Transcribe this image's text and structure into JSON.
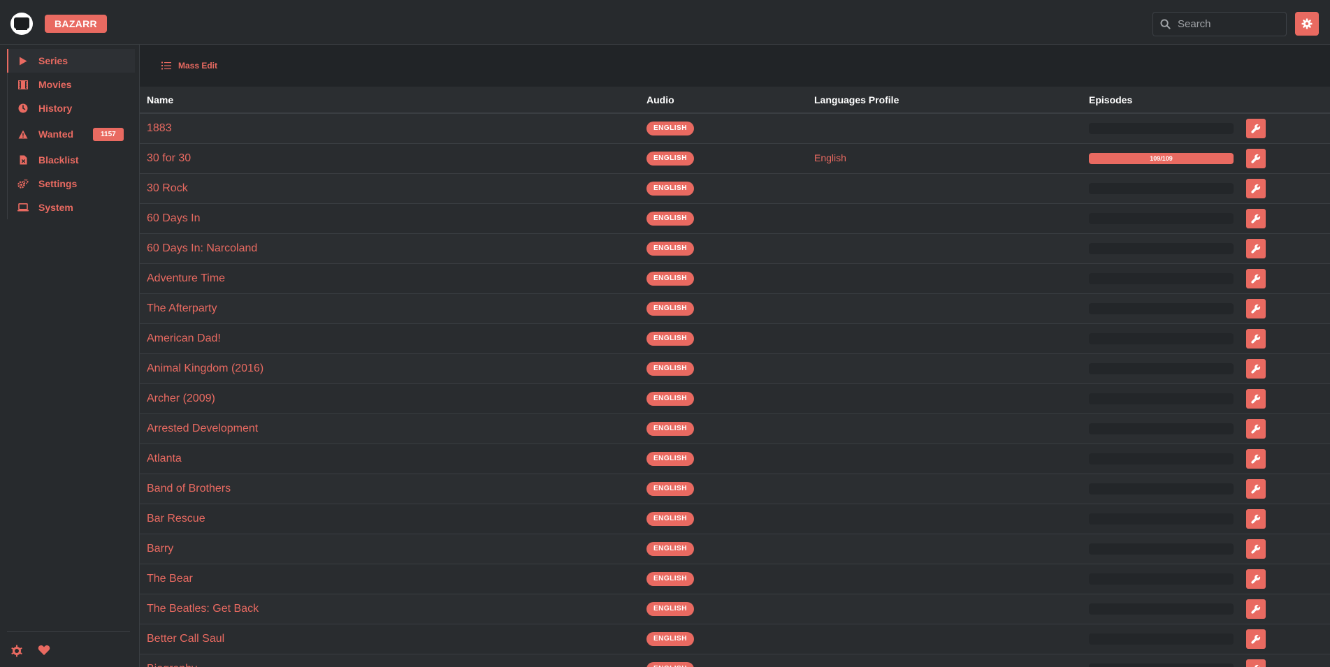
{
  "header": {
    "brand": "BAZARR",
    "search_placeholder": "Search"
  },
  "colors": {
    "accent": "#e96a61",
    "background": "#272a2d"
  },
  "sidebar": {
    "items": [
      {
        "label": "Series",
        "icon": "play-icon",
        "active": true
      },
      {
        "label": "Movies",
        "icon": "film-icon"
      },
      {
        "label": "History",
        "icon": "clock-icon"
      },
      {
        "label": "Wanted",
        "icon": "warning-icon",
        "badge": "1157"
      },
      {
        "label": "Blacklist",
        "icon": "file-x-icon"
      },
      {
        "label": "Settings",
        "icon": "gears-icon"
      },
      {
        "label": "System",
        "icon": "laptop-icon"
      }
    ],
    "footer_icons": [
      "github-icon",
      "heart-icon"
    ]
  },
  "toolbar": {
    "mass_edit": "Mass Edit"
  },
  "table": {
    "columns": [
      "Name",
      "Audio",
      "Languages Profile",
      "Episodes"
    ],
    "rows": [
      {
        "name": "1883",
        "audio": "ENGLISH",
        "profile": "",
        "episodes": "",
        "progress": 0
      },
      {
        "name": "30 for 30",
        "audio": "ENGLISH",
        "profile": "English",
        "episodes": "109/109",
        "progress": 1
      },
      {
        "name": "30 Rock",
        "audio": "ENGLISH",
        "profile": "",
        "episodes": "",
        "progress": 0
      },
      {
        "name": "60 Days In",
        "audio": "ENGLISH",
        "profile": "",
        "episodes": "",
        "progress": 0
      },
      {
        "name": "60 Days In: Narcoland",
        "audio": "ENGLISH",
        "profile": "",
        "episodes": "",
        "progress": 0
      },
      {
        "name": "Adventure Time",
        "audio": "ENGLISH",
        "profile": "",
        "episodes": "",
        "progress": 0
      },
      {
        "name": "The Afterparty",
        "audio": "ENGLISH",
        "profile": "",
        "episodes": "",
        "progress": 0
      },
      {
        "name": "American Dad!",
        "audio": "ENGLISH",
        "profile": "",
        "episodes": "",
        "progress": 0
      },
      {
        "name": "Animal Kingdom (2016)",
        "audio": "ENGLISH",
        "profile": "",
        "episodes": "",
        "progress": 0
      },
      {
        "name": "Archer (2009)",
        "audio": "ENGLISH",
        "profile": "",
        "episodes": "",
        "progress": 0
      },
      {
        "name": "Arrested Development",
        "audio": "ENGLISH",
        "profile": "",
        "episodes": "",
        "progress": 0
      },
      {
        "name": "Atlanta",
        "audio": "ENGLISH",
        "profile": "",
        "episodes": "",
        "progress": 0
      },
      {
        "name": "Band of Brothers",
        "audio": "ENGLISH",
        "profile": "",
        "episodes": "",
        "progress": 0
      },
      {
        "name": "Bar Rescue",
        "audio": "ENGLISH",
        "profile": "",
        "episodes": "",
        "progress": 0
      },
      {
        "name": "Barry",
        "audio": "ENGLISH",
        "profile": "",
        "episodes": "",
        "progress": 0
      },
      {
        "name": "The Bear",
        "audio": "ENGLISH",
        "profile": "",
        "episodes": "",
        "progress": 0
      },
      {
        "name": "The Beatles: Get Back",
        "audio": "ENGLISH",
        "profile": "",
        "episodes": "",
        "progress": 0
      },
      {
        "name": "Better Call Saul",
        "audio": "ENGLISH",
        "profile": "",
        "episodes": "",
        "progress": 0
      },
      {
        "name": "Biography",
        "audio": "ENGLISH",
        "profile": "",
        "episodes": "",
        "progress": 0
      }
    ]
  }
}
